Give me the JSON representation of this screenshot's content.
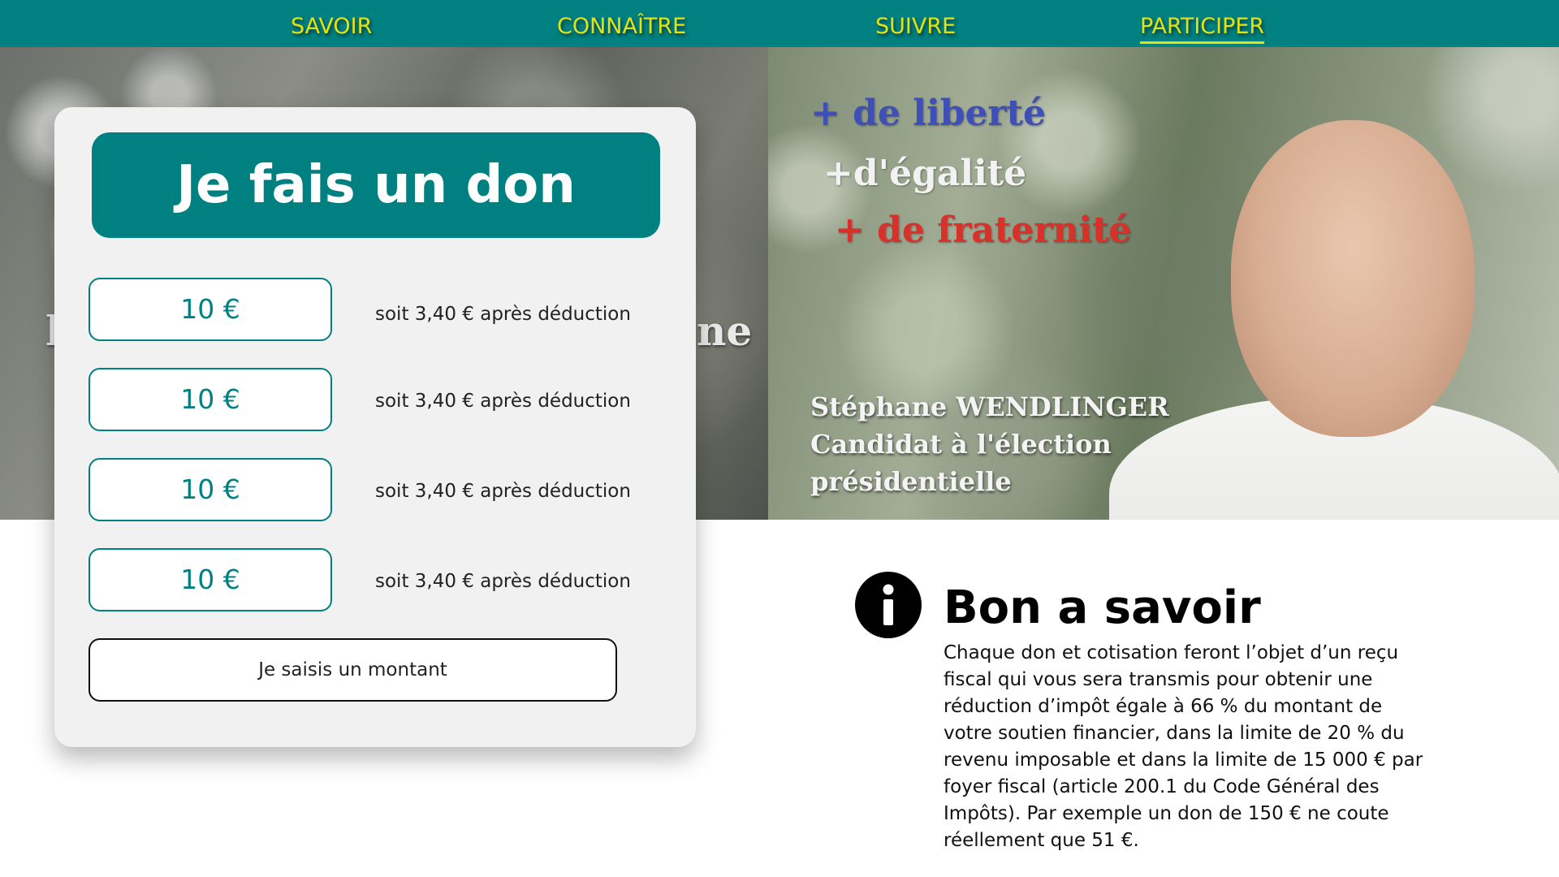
{
  "nav": {
    "items": [
      {
        "label": "SAVOIR"
      },
      {
        "label": "CONNAÎTRE"
      },
      {
        "label": "SUIVRE"
      },
      {
        "label": "PARTICIPER"
      }
    ],
    "active": "PARTICIPER"
  },
  "hero": {
    "left_text_left": "l",
    "left_text_right": "ne",
    "slogans": [
      "+ de liberté",
      "+d'égalité",
      "+ de fraternité"
    ],
    "candidate": {
      "name": "Stéphane WENDLINGER",
      "line2": "Candidat à l'élection",
      "line3": "présidentielle"
    }
  },
  "donation": {
    "title": "Je fais un don",
    "options": [
      {
        "amount": "10 €",
        "note": "soit 3,40 € après déduction"
      },
      {
        "amount": "10 €",
        "note": "soit 3,40 € après déduction"
      },
      {
        "amount": "10 €",
        "note": "soit 3,40 € après déduction"
      },
      {
        "amount": "10 €",
        "note": "soit 3,40 € après déduction"
      }
    ],
    "custom_label": "Je saisis un montant"
  },
  "info": {
    "icon": "info-icon",
    "title": "Bon a savoir",
    "text": "Chaque don et cotisation feront l’objet d’un reçu fiscal qui vous sera transmis pour obtenir une réduction d’impôt égale à 66 % du montant de votre soutien financier, dans la limite de 20 % du revenu imposable et dans la limite de 15 000 € par foyer fiscal (article 200.1 du Code Général des Impôts). Par exemple un don de 150 € ne coute réellement que 51 €."
  },
  "colors": {
    "teal": "#008080",
    "nav_text": "#e3e314",
    "card_bg": "#f1f1f1"
  }
}
